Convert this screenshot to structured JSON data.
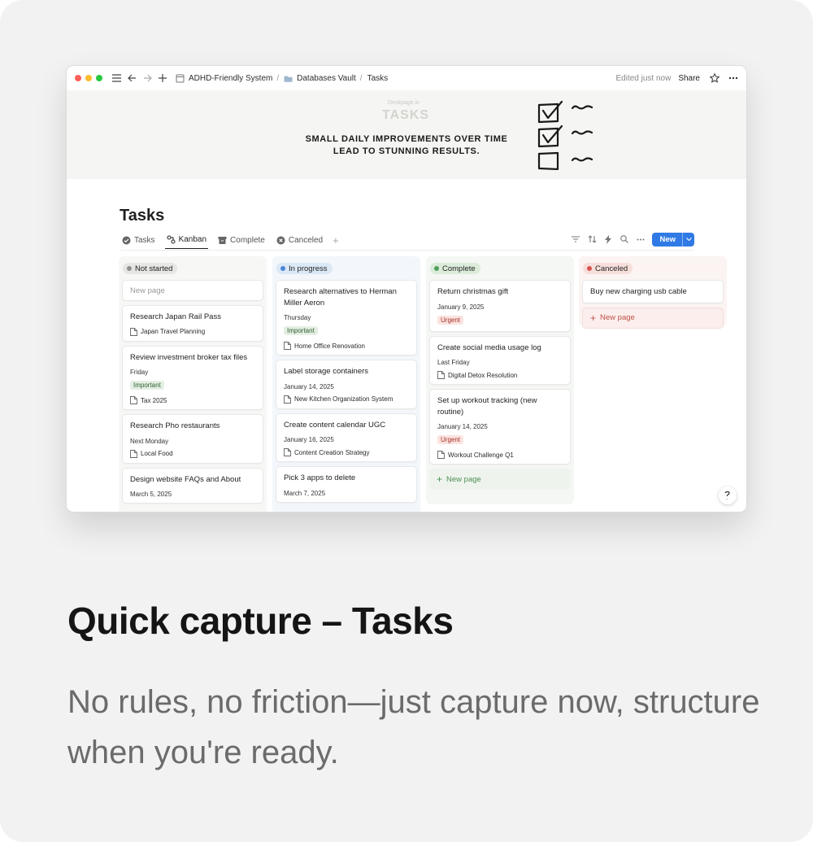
{
  "colors": {
    "accent": "#2f7ae5",
    "not_started": "#9b9b9b",
    "in_progress": "#4a86d8",
    "complete": "#4fa05a",
    "canceled": "#d9534f"
  },
  "window": {
    "breadcrumbs": [
      {
        "label": "ADHD-Friendly System",
        "icon": "page-icon"
      },
      {
        "label": "Databases Vault",
        "icon": "folder-icon"
      },
      {
        "label": "Tasks",
        "icon": ""
      }
    ],
    "edited": "Edited just now",
    "share": "Share"
  },
  "banner": {
    "site": "Deskpage.io",
    "title": "TASKS",
    "quote_line1": "SMALL DAILY IMPROVEMENTS OVER TIME",
    "quote_line2": "LEAD TO STUNNING RESULTS."
  },
  "page": {
    "title": "Tasks",
    "tabs": [
      {
        "label": "Tasks",
        "icon": "check-circle-icon"
      },
      {
        "label": "Kanban",
        "icon": "kanban-icon",
        "active": true
      },
      {
        "label": "Complete",
        "icon": "archive-icon"
      },
      {
        "label": "Canceled",
        "icon": "x-circle-icon"
      }
    ],
    "new_button": "New"
  },
  "board": {
    "new_page": "New page",
    "columns": [
      {
        "status": "Not started",
        "cards": [
          {
            "title": "Research Japan Rail Pass",
            "relation": "Japan Travel Planning"
          },
          {
            "title": "Review investment broker tax files",
            "date": "Friday",
            "tag": "Important",
            "relation": "Tax 2025"
          },
          {
            "title": "Research Pho restaurants",
            "date": "Next Monday",
            "relation": "Local Food"
          },
          {
            "title": "Design website FAQs and About",
            "date": "March 5, 2025"
          }
        ]
      },
      {
        "status": "In progress",
        "cards": [
          {
            "title": "Research alternatives to Herman Miller Aeron",
            "date": "Thursday",
            "tag": "Important",
            "relation": "Home Office Renovation"
          },
          {
            "title": "Label storage containers",
            "date": "January 14, 2025",
            "relation": "New Kitchen Organization System"
          },
          {
            "title": "Create content calendar UGC",
            "date": "January 16, 2025",
            "relation": "Content Creation Strategy"
          },
          {
            "title": "Pick 3 apps to delete",
            "date": "March 7, 2025"
          }
        ]
      },
      {
        "status": "Complete",
        "cards": [
          {
            "title": "Return christmas gift",
            "date": "January 9, 2025",
            "tag": "Urgent"
          },
          {
            "title": "Create social media usage log",
            "date": "Last Friday",
            "relation": "Digital Detox Resolution"
          },
          {
            "title": "Set up workout tracking (new routine)",
            "date": "January 14, 2025",
            "tag": "Urgent",
            "relation": "Workout Challenge Q1"
          }
        ]
      },
      {
        "status": "Canceled",
        "cards": [
          {
            "title": "Buy new charging usb cable"
          }
        ]
      }
    ]
  },
  "caption": {
    "headline": "Quick capture – Tasks",
    "subtext": "No rules, no friction—just capture now, structure when you're ready."
  }
}
